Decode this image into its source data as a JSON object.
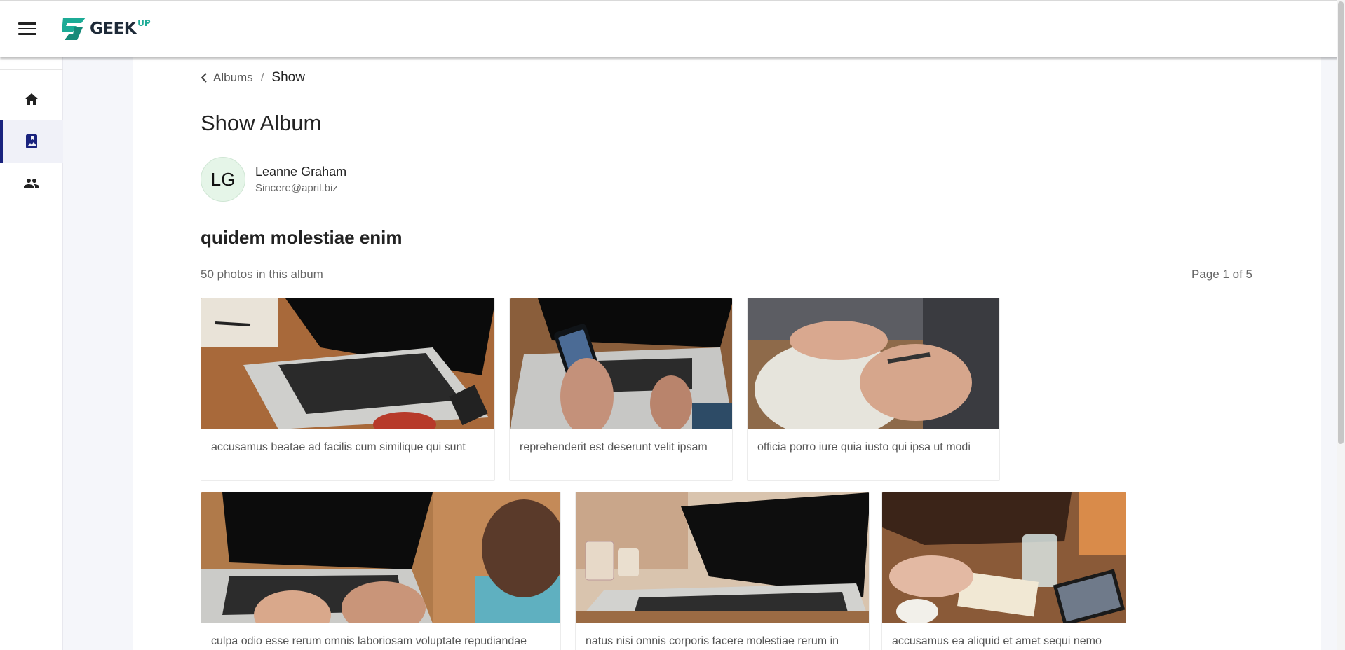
{
  "header": {
    "logo_text": "GEEK",
    "logo_sup": "UP"
  },
  "sidebar": {
    "items": [
      {
        "icon": "home-icon",
        "active": false
      },
      {
        "icon": "album-icon",
        "active": true
      },
      {
        "icon": "users-icon",
        "active": false
      }
    ]
  },
  "breadcrumb": {
    "parent": "Albums",
    "separator": "/",
    "current": "Show"
  },
  "page_title": "Show Album",
  "owner": {
    "initials": "LG",
    "name": "Leanne Graham",
    "email": "Sincere@april.biz"
  },
  "album": {
    "title": "quidem molestiae enim",
    "photo_count": "50 photos in this album",
    "page_info": "Page 1 of 5"
  },
  "photos": [
    {
      "caption": "accusamus beatae ad facilis cum similique qui sunt",
      "image": "laptop-with-notebook"
    },
    {
      "caption": "reprehenderit est deserunt velit ipsam",
      "image": "phone-over-laptop"
    },
    {
      "caption": "officia porro iure quia iusto qui ipsa ut modi",
      "image": "hands-writing"
    },
    {
      "caption": "culpa odio esse rerum omnis laboriosam voluptate repudiandae",
      "image": "typing-on-laptop"
    },
    {
      "caption": "natus nisi omnis corporis facere molestiae rerum in",
      "image": "laptop-on-table"
    },
    {
      "caption": "accusamus ea aliquid et amet sequi nemo",
      "image": "meeting-table"
    }
  ],
  "colors": {
    "accent": "#1a237e",
    "logo_teal": "#1cab96",
    "avatar_bg": "#e5f5e8"
  }
}
